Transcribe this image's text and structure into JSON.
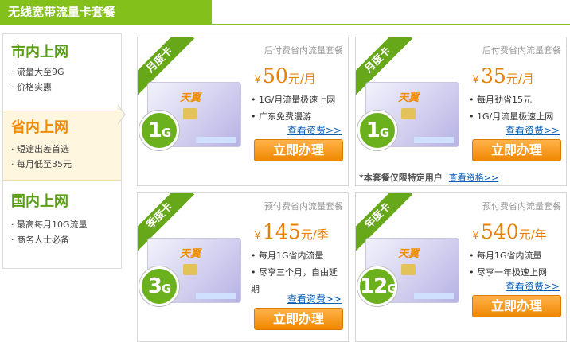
{
  "header": {
    "title": "无线宽带流量卡套餐"
  },
  "sidebar": {
    "groups": [
      {
        "title": "市内上网",
        "lines": [
          "流量大至9G",
          "价格实惠"
        ]
      },
      {
        "title": "省内上网",
        "lines": [
          "短途出差首选",
          "每月低至35元"
        ]
      },
      {
        "title": "国内上网",
        "lines": [
          "最高每月10G流量",
          "商务人士必备"
        ]
      }
    ]
  },
  "cards": [
    {
      "ribbon": "月度卡",
      "plan_title": "后付费省内流量套餐",
      "badge_num": "1",
      "badge_unit": "G",
      "currency": "￥",
      "price": "50",
      "unit": "元/月",
      "features": [
        "1G/月流量极速上网",
        "广东免费漫游"
      ],
      "detail_link": "查看资费>>",
      "button": "立即办理"
    },
    {
      "ribbon": "月度卡",
      "plan_title": "后付费省内流量套餐",
      "badge_num": "1",
      "badge_unit": "G",
      "currency": "￥",
      "price": "35",
      "unit": "元/月",
      "features": [
        "每月劲省15元",
        "1G/月流量极速上网"
      ],
      "detail_link": "查看资费>>",
      "button": "立即办理",
      "note": "*本套餐仅限特定用户",
      "note_link": "查看资格>>"
    },
    {
      "ribbon": "季度卡",
      "plan_title": "预付费省内流量套餐",
      "badge_num": "3",
      "badge_unit": "G",
      "currency": "￥",
      "price": "145",
      "unit": "元/季",
      "features": [
        "每月1G省内流量",
        "尽享三个月，自由延期"
      ],
      "detail_link": "查看资费>>",
      "button": "立即办理"
    },
    {
      "ribbon": "年度卡",
      "plan_title": "预付费省内流量套餐",
      "badge_num": "12",
      "badge_unit": "G",
      "currency": "￥",
      "price": "540",
      "unit": "元/年",
      "features": [
        "每月1G省内流量",
        "尽享一年极速上网"
      ],
      "detail_link": "查看资费>>",
      "button": "立即办理"
    }
  ],
  "card_image": {
    "brand": "天翼"
  },
  "colors": {
    "brand_green": "#84c01c",
    "accent_orange": "#f08700",
    "link_blue": "#0b5fb7"
  }
}
